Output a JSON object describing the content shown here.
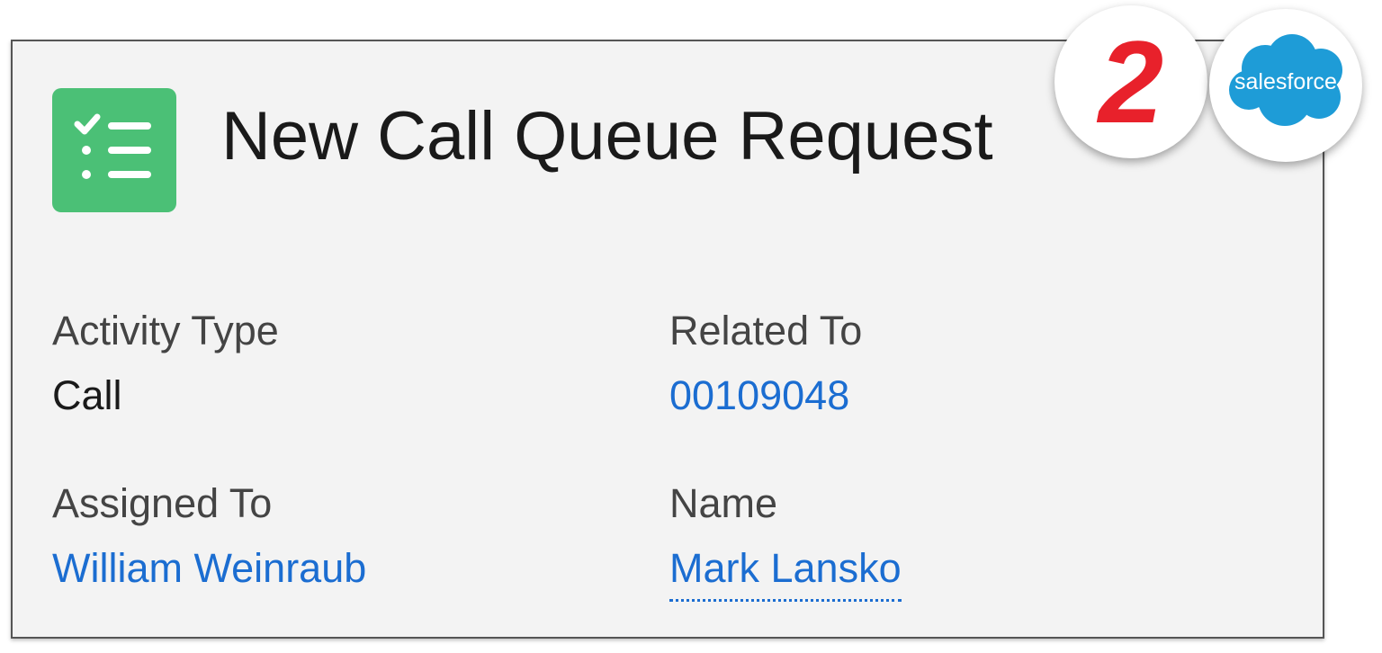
{
  "header": {
    "title": "New Call Queue Request",
    "icon": "task-list-icon",
    "icon_color": "#4bc076"
  },
  "fields": {
    "activity_type": {
      "label": "Activity Type",
      "value": "Call"
    },
    "related_to": {
      "label": "Related To",
      "value": "00109048"
    },
    "assigned_to": {
      "label": "Assigned To",
      "value": "William Weinraub"
    },
    "name": {
      "label": "Name",
      "value": "Mark Lansko"
    }
  },
  "badges": {
    "step_number": "2",
    "step_color": "#e8212b",
    "brand_label": "salesforce",
    "brand_color": "#1e9cd7"
  },
  "colors": {
    "link": "#1b6dd1",
    "card_background": "#f3f3f3"
  }
}
